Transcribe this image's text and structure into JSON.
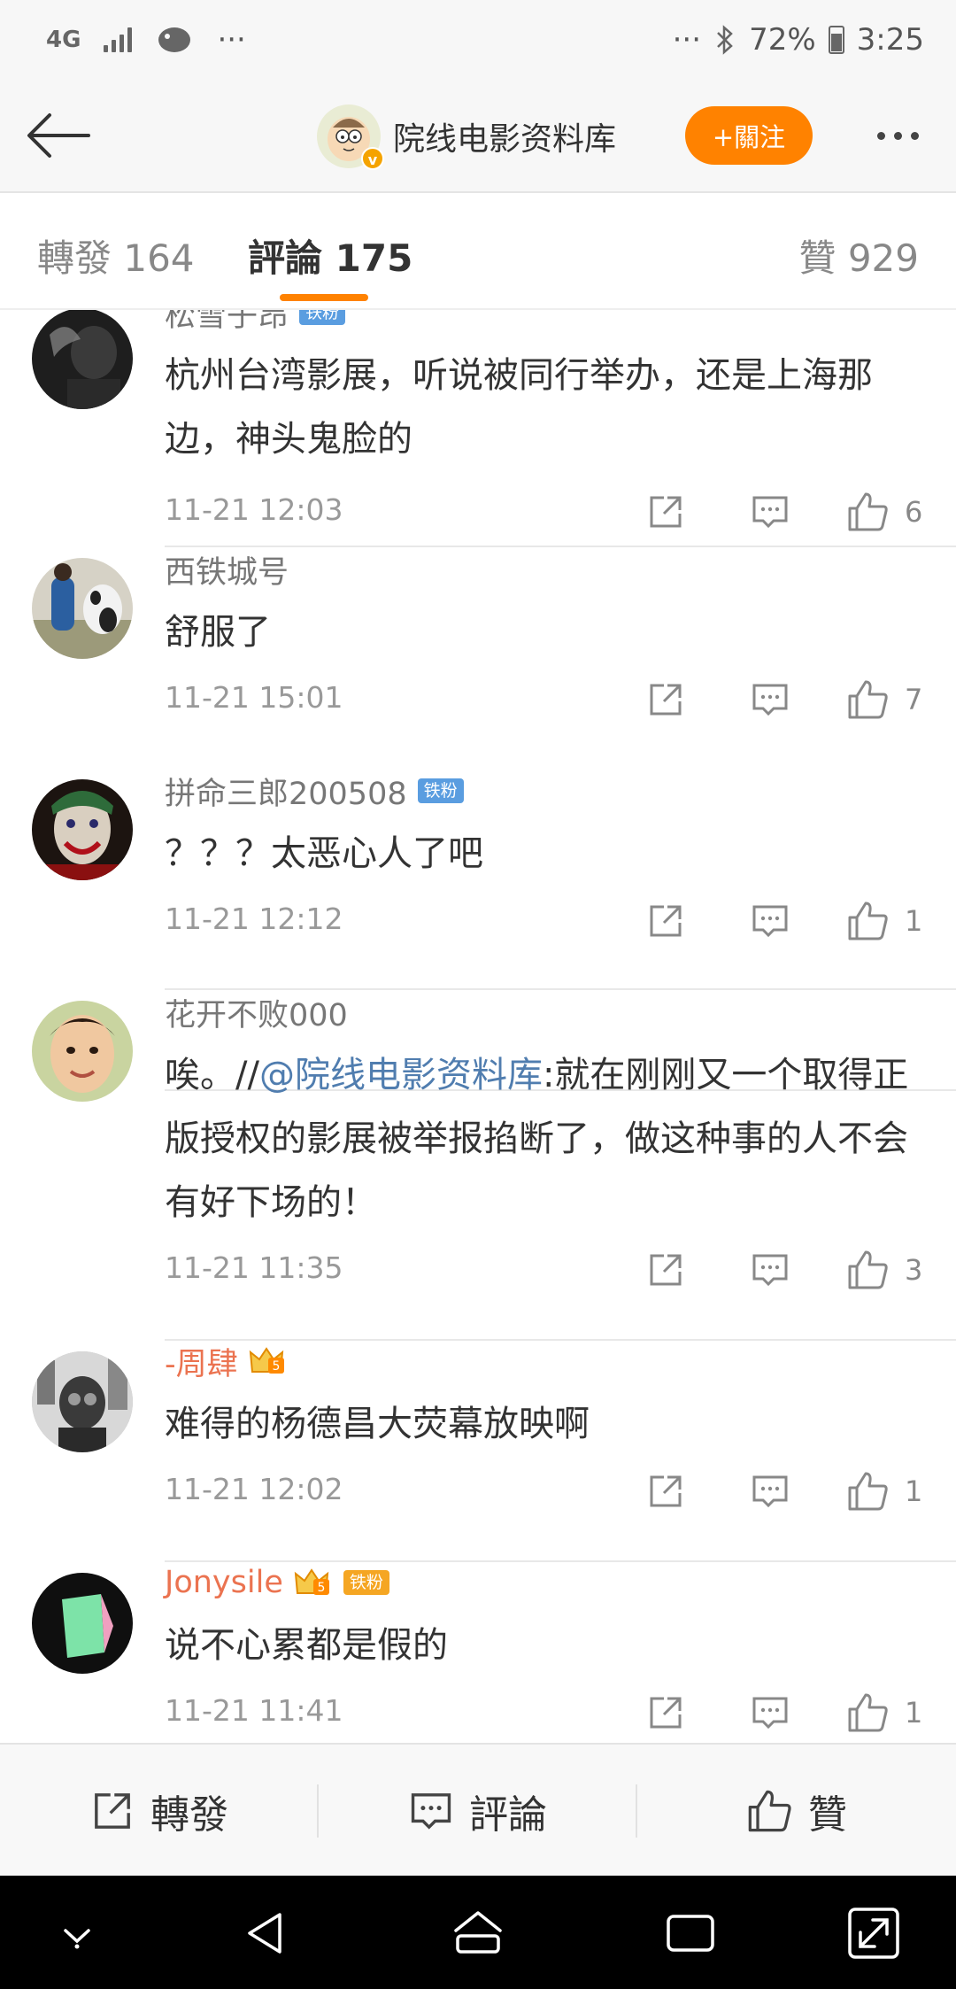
{
  "status_bar": {
    "network": "4G",
    "dots_left": "···",
    "dots_right": "···",
    "battery": "72%",
    "time": "3:25"
  },
  "header": {
    "title": "院线电影资料库",
    "follow_label": "+關注"
  },
  "tabs": {
    "repost": "轉發 164",
    "comment": "評論 175",
    "like": "贊 929"
  },
  "comments": [
    {
      "name": "松雪子昂",
      "badge": "铁粉",
      "text": "杭州台湾影展，听说被同行举办，还是上海那边，神头鬼脸的",
      "time": "11-21 12:03",
      "likes": "6"
    },
    {
      "name": "西铁城号",
      "text": "舒服了",
      "time": "11-21 15:01",
      "likes": "7"
    },
    {
      "name": "拼命三郎200508",
      "badge": "铁粉",
      "text": "？？？太恶心人了吧",
      "time": "11-21 12:12",
      "likes": "1"
    },
    {
      "name": "花开不败000",
      "text_prefix": "唉。//",
      "mention": "@院线电影资料库",
      "text_suffix": ":就在刚刚又一个取得正版授权的影展被举报掐断了，做这种事的人不会有好下场的！",
      "time": "11-21 11:35",
      "likes": "3"
    },
    {
      "name": "-周肆",
      "vip": "5",
      "text": "难得的杨德昌大荧幕放映啊",
      "time": "11-21 12:02",
      "likes": "1"
    },
    {
      "name": "Jonysile",
      "vip": "5",
      "badge": "铁粉",
      "text": "说不心累都是假的",
      "time": "11-21 11:41",
      "likes": "1"
    }
  ],
  "bottom_bar": {
    "repost": "轉發",
    "comment": "評論",
    "like": "贊"
  },
  "colors": {
    "accent": "#ff8200",
    "mention": "#507daf",
    "vip_name": "#eb7350",
    "fan_badge": "#5a9de0"
  }
}
